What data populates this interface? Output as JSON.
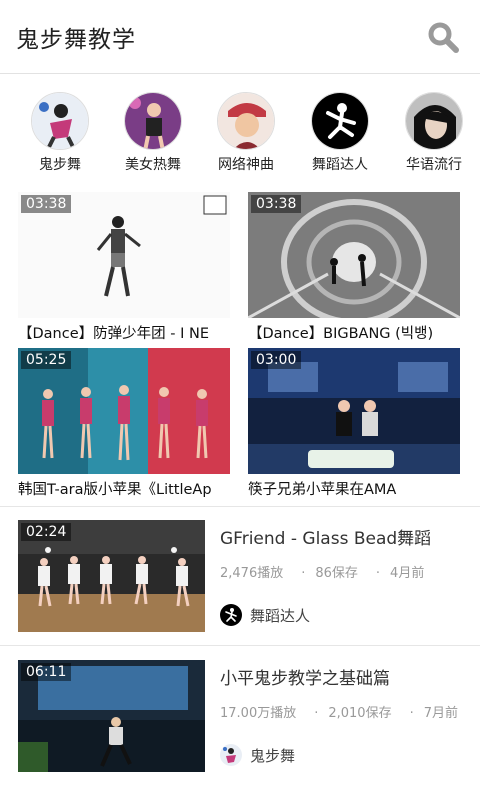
{
  "header": {
    "title": "鬼步舞教学",
    "search_icon": "search-icon"
  },
  "categories": [
    {
      "label": "鬼步舞"
    },
    {
      "label": "美女热舞"
    },
    {
      "label": "网络神曲"
    },
    {
      "label": "舞蹈达人"
    },
    {
      "label": "华语流行"
    }
  ],
  "grid": [
    {
      "duration": "03:38",
      "title": "【Dance】防弹少年团 - I NE"
    },
    {
      "duration": "03:38",
      "title": "【Dance】BIGBANG (빅뱅)"
    },
    {
      "duration": "05:25",
      "title": "韩国T-ara版小苹果《LittleAp"
    },
    {
      "duration": "03:00",
      "title": "筷子兄弟小苹果在AMA"
    }
  ],
  "list": [
    {
      "duration": "02:24",
      "title": "GFriend - Glass Bead舞蹈",
      "plays": "2,476播放",
      "saves": "86保存",
      "age": "4月前",
      "author": "舞蹈达人"
    },
    {
      "duration": "06:11",
      "title": "小平鬼步教学之基础篇",
      "plays": "17.00万播放",
      "saves": "2,010保存",
      "age": "7月前",
      "author": "鬼步舞"
    }
  ],
  "colors": {
    "divider": "#e6e6e6",
    "meta_text": "#999999",
    "icon_gray": "#9a9a9a"
  }
}
